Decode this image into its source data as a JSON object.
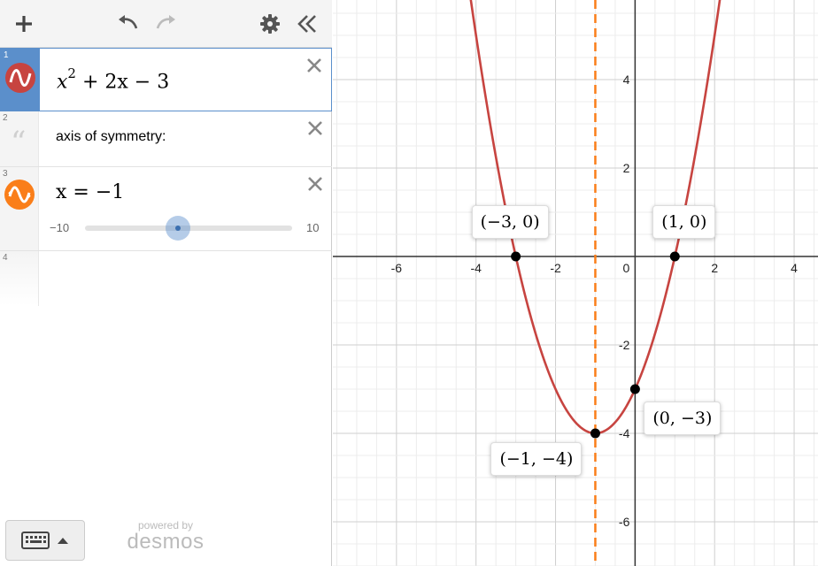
{
  "toolbar": {
    "add_icon": "plus-icon",
    "undo_icon": "undo-icon",
    "redo_icon": "redo-icon",
    "settings_icon": "gear-icon",
    "collapse_icon": "double-chevron-left-icon"
  },
  "expressions": [
    {
      "index": "1",
      "type": "expression",
      "color": "#c74440",
      "base": "x",
      "exponent": "2",
      "rest": "+ 2x − 3",
      "selected": true
    },
    {
      "index": "2",
      "type": "note",
      "text": "axis of symmetry:"
    },
    {
      "index": "3",
      "type": "slider",
      "color": "#fa7e19",
      "latex": "x = −1",
      "value": -1,
      "min": "−10",
      "max": "10"
    },
    {
      "index": "4",
      "type": "empty"
    }
  ],
  "footer": {
    "keyboard_icon": "keyboard-icon",
    "powered_by": "powered by",
    "brand": "desmos"
  },
  "graph": {
    "x_range": [
      -7.6,
      4.6
    ],
    "y_range": [
      -7.0,
      5.8
    ],
    "x_ticks": [
      "-6",
      "-4",
      "-2",
      "0",
      "2",
      "4"
    ],
    "y_ticks": [
      "4",
      "2",
      "-2",
      "-4",
      "-6"
    ],
    "curve_color": "#c74440",
    "symmetry_color": "#fa7e19",
    "points": [
      {
        "label": "(−3, 0)",
        "x": -3,
        "y": 0
      },
      {
        "label": "(1, 0)",
        "x": 1,
        "y": 0
      },
      {
        "label": "(0, −3)",
        "x": 0,
        "y": -3
      },
      {
        "label": "(−1, −4)",
        "x": -1,
        "y": -4
      }
    ]
  }
}
